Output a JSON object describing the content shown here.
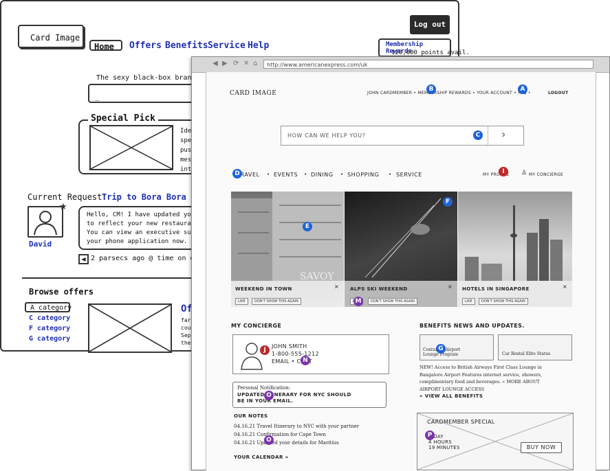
{
  "back": {
    "logo": "Card Image",
    "logout": "Log out",
    "nav": [
      "Home",
      "Offers",
      "Benefits",
      "Service",
      "Help"
    ],
    "rewards_title": "Membership Rewards",
    "rewards_points": "120,000 points avail.",
    "brand_statement": "The sexy black-box brand stat",
    "search_cursor": "_",
    "special_pick": "Special Pick",
    "special_text": [
      "Ide",
      "spe",
      "pus",
      "mes",
      "int"
    ],
    "current_request_label": "Current Request:",
    "current_request_value": "Trip to Bora Bora",
    "message_lines": [
      "Hello, CM! I have updated your re",
      "to reflect your new restaurant ch",
      "You can view an executive summar",
      "your phone application now. Enjoy"
    ],
    "agent_name": "David",
    "time_text": "2 parsecs ago @ time on da",
    "browse_offers": "Browse offers",
    "categories": [
      "A category",
      "C category",
      "F category",
      "G category"
    ],
    "offer_title": "Of",
    "offer_text": [
      "far",
      "coun",
      "Sepa",
      "the"
    ]
  },
  "browser": {
    "url": "http://www.americanexpress.com/uk",
    "controls": [
      "◀",
      "▶",
      "⟳",
      "✕",
      "⌂"
    ],
    "logo": "CARD IMAGE",
    "util_nav": "JOHN CARDMEMBER • MEMBERSHIP REWARDS • YOUR ACCOUNT • FAQ •",
    "logout": "LOGOUT",
    "search_placeholder": "HOW CAN WE HELP YOU?",
    "search_arrow": "›",
    "main_nav": [
      "TRAVEL",
      "EVENTS",
      "DINING",
      "SHOPPING",
      "SERVICE"
    ],
    "nav_sep": "•",
    "my_profile": "MY PROFILE",
    "my_concierge_nav": "MY CONCIERGE",
    "tiles": [
      {
        "title": "WEEKEND IN TOWN",
        "like": "LIKE",
        "hide": "DON'T SHOW THIS AGAIN",
        "close": "×"
      },
      {
        "title": "ALPS SKI WEEKEND",
        "like": "LIKE",
        "hide": "DON'T SHOW THIS AGAIN",
        "close": "×"
      },
      {
        "title": "HOTELS IN SINGAPORE",
        "like": "LIKE",
        "hide": "DON'T SHOW THIS AGAIN",
        "close": "×"
      }
    ],
    "concierge_heading": "MY CONCIERGE",
    "contact_name": "JOHN SMITH",
    "contact_phone": "1-800-555-1212",
    "contact_links": "EMAIL • CHAT",
    "notification_label": "Personal Notification:",
    "notification_text": [
      "UPDATED ITINERARY FOR NYC SHOULD",
      "BE IN YOUR EMAIL."
    ],
    "notes_heading": "OUR NOTES",
    "notes": [
      "04.16.21 Travel Itinerary to NYC with your partner",
      "04.16.21 Confirmation for Cape Town",
      "04.16.21 Updated your details for Maritius"
    ],
    "calendar_link": "YOUR CALENDAR »",
    "benefits_heading": "BENEFITS NEWS AND UPDATES.",
    "benefit_1": [
      "Centurion Airport",
      "Lounge Program"
    ],
    "benefit_2": "Car Rental Elite Status",
    "news_lines": [
      "NEW! Access to British Airways First Class Lounge in",
      "Bangalore Airport Features internet service, showers,",
      "complimentary food and beverages. » MORE ABOUT",
      "AIRPORT LOUNGE ACCESS"
    ],
    "view_all": "» VIEW ALL BENEFITS",
    "special_heading": "CARDMEMBER SPECIAL",
    "special_lines": [
      "1 DAY",
      "4 HOURS",
      "19 MINUTES"
    ],
    "buy_now": "BUY NOW",
    "markers": {
      "A": "A",
      "B": "B",
      "C": "C",
      "D": "D",
      "E": "E",
      "F": "F",
      "G": "G",
      "I": "I",
      "J": "J",
      "M": "M",
      "N": "N",
      "O": "O",
      "P": "P"
    }
  },
  "colors": {
    "sketch_blue": "#1f2fae",
    "marker_blue": "#1f63d6",
    "marker_red": "#c0282b",
    "marker_purple": "#7b35a8"
  }
}
